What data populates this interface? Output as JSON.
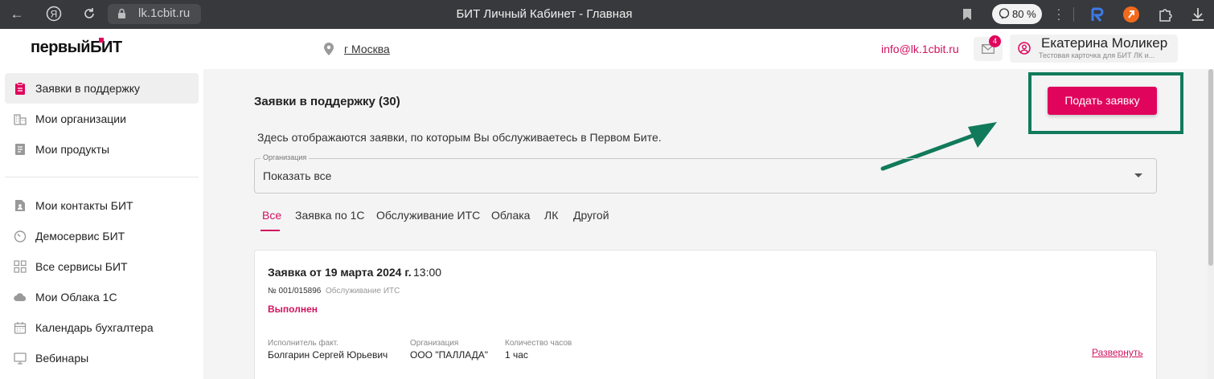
{
  "browser": {
    "url": "lk.1cbit.ru",
    "title": "БИТ Личный Кабинет - Главная",
    "zoom": "80 %",
    "icons": [
      "back-icon",
      "yandex-icon",
      "reload-icon",
      "lock-icon",
      "bookmark-icon",
      "zoom-icon",
      "menu-kebab-icon",
      "extension-icons"
    ]
  },
  "header": {
    "logo": "первыйБИТ",
    "city": "г Москва",
    "email": "info@lk.1cbit.ru",
    "mail_badge": "4",
    "user_name": "Екатерина Моликер",
    "user_sub": "Тестовая карточка для БИТ ЛК и..."
  },
  "sidebar": {
    "items": [
      {
        "label": "Заявки в поддержку",
        "icon": "clipboard-icon",
        "active": true
      },
      {
        "label": "Мои организации",
        "icon": "building-icon",
        "active": false
      },
      {
        "label": "Мои продукты",
        "icon": "document-icon",
        "active": false
      },
      {
        "label": "Мои контакты БИТ",
        "icon": "contact-file-icon",
        "active": false
      },
      {
        "label": "Демосервис БИТ",
        "icon": "timer-icon",
        "active": false
      },
      {
        "label": "Все сервисы БИТ",
        "icon": "grid-icon",
        "active": false
      },
      {
        "label": "Мои Облака 1С",
        "icon": "cloud-icon",
        "active": false
      },
      {
        "label": "Календарь бухгалтера",
        "icon": "calendar-icon",
        "active": false
      },
      {
        "label": "Вебинары",
        "icon": "monitor-icon",
        "active": false
      }
    ]
  },
  "main": {
    "title": "Заявки в поддержку (30)",
    "description": "Здесь отображаются заявки, по которым Вы обслуживаетесь в Первом Бите.",
    "submit_label": "Подать заявку",
    "filter": {
      "label": "Организация",
      "value": "Показать все"
    },
    "tabs": [
      "Все",
      "Заявка по 1С",
      "Обслуживание ИТС",
      "Облака",
      "ЛК",
      "Другой"
    ],
    "card": {
      "title": "Заявка от 19 марта 2024 г.",
      "time": "13:00",
      "number": "№ 001/015896",
      "type": "Обслуживание ИТС",
      "status": "Выполнен",
      "columns": [
        {
          "header": "Исполнитель факт.",
          "value": "Болгарин Сергей Юрьевич"
        },
        {
          "header": "Организация",
          "value": "ООО \"ПАЛЛАДА\""
        },
        {
          "header": "Количество часов",
          "value": "1 час"
        }
      ],
      "expand_label": "Развернуть"
    }
  },
  "colors": {
    "accent": "#e0045c",
    "highlight_frame": "#117a5a",
    "chrome": "#38393c"
  }
}
